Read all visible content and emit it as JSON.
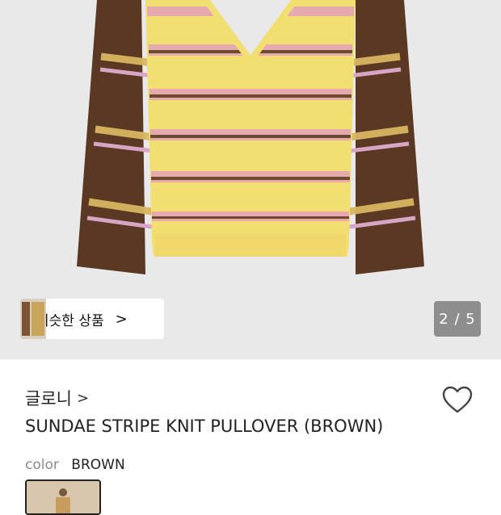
{
  "gallery": {
    "similar_label": "비슷한 상품",
    "similar_chevron": ">",
    "counter": "2 / 5"
  },
  "product": {
    "brand": "글로니",
    "brand_chevron": ">",
    "name": "SUNDAE STRIPE KNIT PULLOVER (BROWN)",
    "color_label": "color",
    "color_value": "BROWN"
  },
  "icons": {
    "wishlist": "heart-outline-icon",
    "similar": "chevron-right-icon"
  },
  "colors": {
    "sweater_yellow": "#f2df72",
    "sleeve_brown": "#5b3823",
    "stripe_pink": "#e6a9ae",
    "stripe_brown": "#6b4a2e",
    "bg_grey": "#e9e9e9"
  }
}
